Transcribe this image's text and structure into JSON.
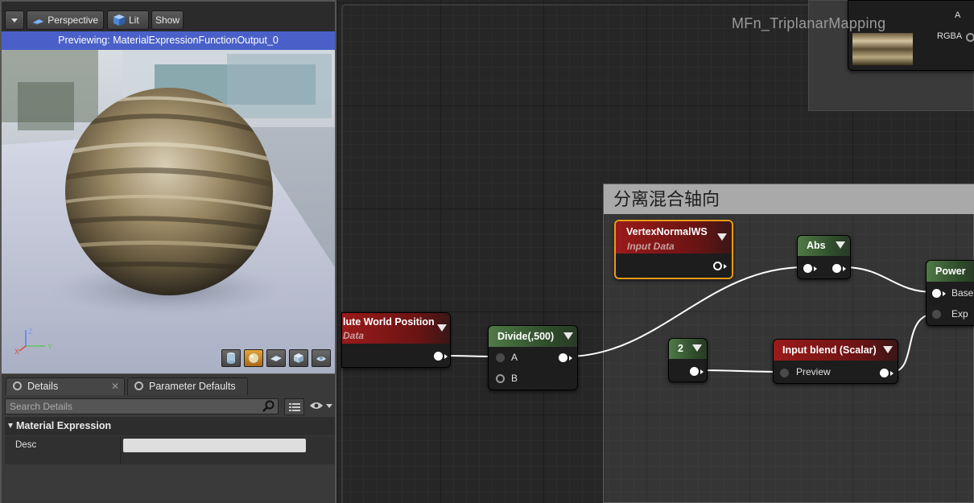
{
  "viewport": {
    "dropdown_icon": "chevron-down-icon",
    "perspective_label": "Perspective",
    "lit_label": "Lit",
    "show_label": "Show",
    "banner": "Previewing: MaterialExpressionFunctionOutput_0",
    "axis_labels": {
      "x": "X",
      "y": "Y",
      "z": "Z"
    },
    "preview_shapes": [
      "cylinder-icon",
      "sphere-icon",
      "plane-icon",
      "cube-icon",
      "custom-mesh-icon"
    ],
    "active_shape": "sphere-icon"
  },
  "details": {
    "tabs": [
      {
        "label": "Details",
        "icon": "search-icon"
      },
      {
        "label": "Parameter Defaults",
        "icon": "search-icon"
      }
    ],
    "search_placeholder": "Search Details",
    "section": "Material Expression",
    "rows": [
      {
        "label": "Desc",
        "value": ""
      }
    ]
  },
  "graph": {
    "title": "MFn_TriplanarMapping",
    "comment_title": "分离混合轴向",
    "top_node_pins": [
      "A",
      "RGBA"
    ],
    "nodes": {
      "world_position": {
        "title": "lute World Position",
        "subtitle": "Data"
      },
      "divide": {
        "title": "Divide(,500)",
        "pins": [
          "A",
          "B"
        ]
      },
      "vertex_normal": {
        "title": "VertexNormalWS",
        "subtitle": "Input Data"
      },
      "abs": {
        "title": "Abs"
      },
      "constant": {
        "title": "2"
      },
      "input_blend": {
        "title": "Input blend (Scalar)",
        "pin": "Preview"
      },
      "power": {
        "title": "Power",
        "pins": [
          "Base",
          "Exp"
        ]
      }
    }
  },
  "colors": {
    "accent_banner": "#4a60c8",
    "selected_node_border": "#e89a1a",
    "green_node": "#4f7a46",
    "red_node": "#9b1a1a"
  }
}
